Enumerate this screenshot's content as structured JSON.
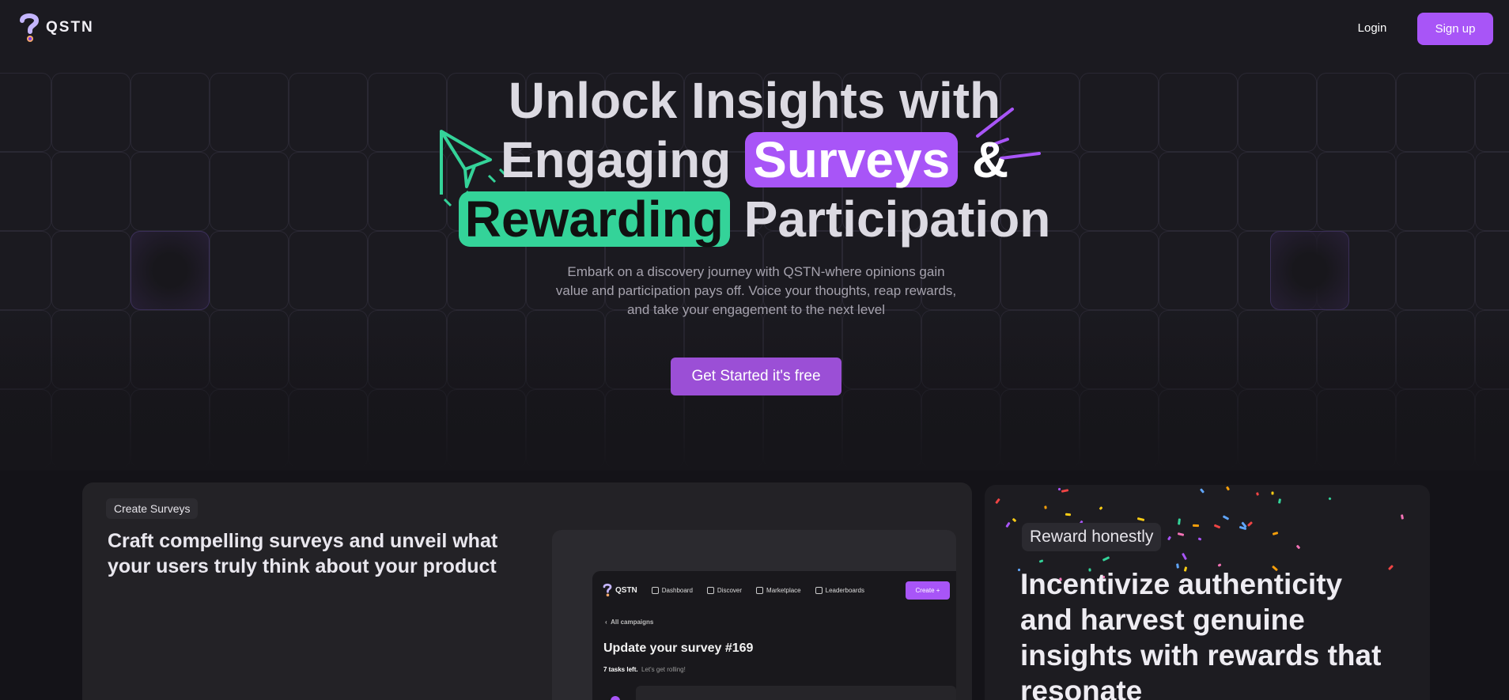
{
  "nav": {
    "brand": "QSTN",
    "login_label": "Login",
    "signup_label": "Sign up"
  },
  "hero": {
    "line1": "Unlock Insights with",
    "line2_a": "Engaging",
    "line2_highlight": "Surveys",
    "line2_b": "&",
    "line3_highlight": "Rewarding",
    "line3_b": "Participation",
    "subtitle": "Embark on a discovery journey with QSTN-where opinions gain value and participation pays off. Voice your thoughts, reap rewards, and take your engagement to the next level",
    "cta_label": "Get Started it's free"
  },
  "create_card": {
    "tag": "Create Surveys",
    "title": "Craft compelling surveys and unveil what your users truly think about your product",
    "preview": {
      "brand": "QSTN",
      "links": [
        "Dashboard",
        "Discover",
        "Marketplace",
        "Leaderboards"
      ],
      "link_icons": [
        "home-icon",
        "discover-icon",
        "marketplace-icon",
        "leaderboard-icon"
      ],
      "create_label": "Create",
      "back_label": "All campaigns",
      "title": "Update your survey #169",
      "tasks_left": "7 tasks left.",
      "tasks_cta": "Let's get rolling!"
    }
  },
  "reward_card": {
    "tag": "Reward honestly",
    "title": "Incentivize authenticity and harvest genuine insights with rewards that resonate"
  },
  "colors": {
    "accent_purple": "#a855f7",
    "accent_green": "#34d399",
    "background": "#18171c"
  }
}
